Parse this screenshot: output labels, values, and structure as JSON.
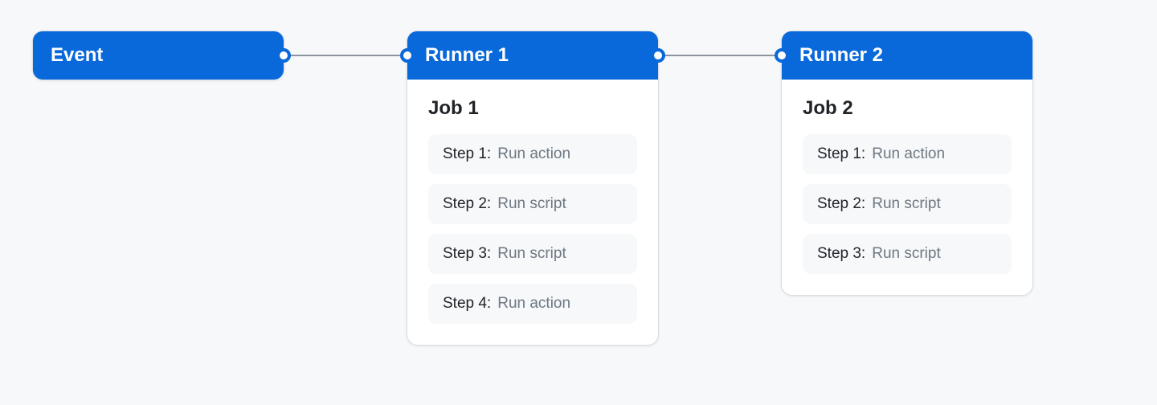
{
  "colors": {
    "accent": "#0969da",
    "page_bg": "#f6f8fa",
    "card_bg": "#ffffff",
    "step_bg": "#f6f8fa",
    "text_primary": "#1f2328",
    "text_muted": "#6e7781",
    "border": "#d8dee4",
    "connector": "#8c959f"
  },
  "diagram": {
    "event": {
      "title": "Event"
    },
    "runners": [
      {
        "title": "Runner 1",
        "job_title": "Job 1",
        "steps": [
          {
            "label": "Step 1:",
            "desc": "Run action"
          },
          {
            "label": "Step 2:",
            "desc": "Run script"
          },
          {
            "label": "Step 3:",
            "desc": "Run script"
          },
          {
            "label": "Step 4:",
            "desc": "Run action"
          }
        ]
      },
      {
        "title": "Runner 2",
        "job_title": "Job 2",
        "steps": [
          {
            "label": "Step 1:",
            "desc": "Run action"
          },
          {
            "label": "Step 2:",
            "desc": "Run script"
          },
          {
            "label": "Step 3:",
            "desc": "Run script"
          }
        ]
      }
    ]
  }
}
